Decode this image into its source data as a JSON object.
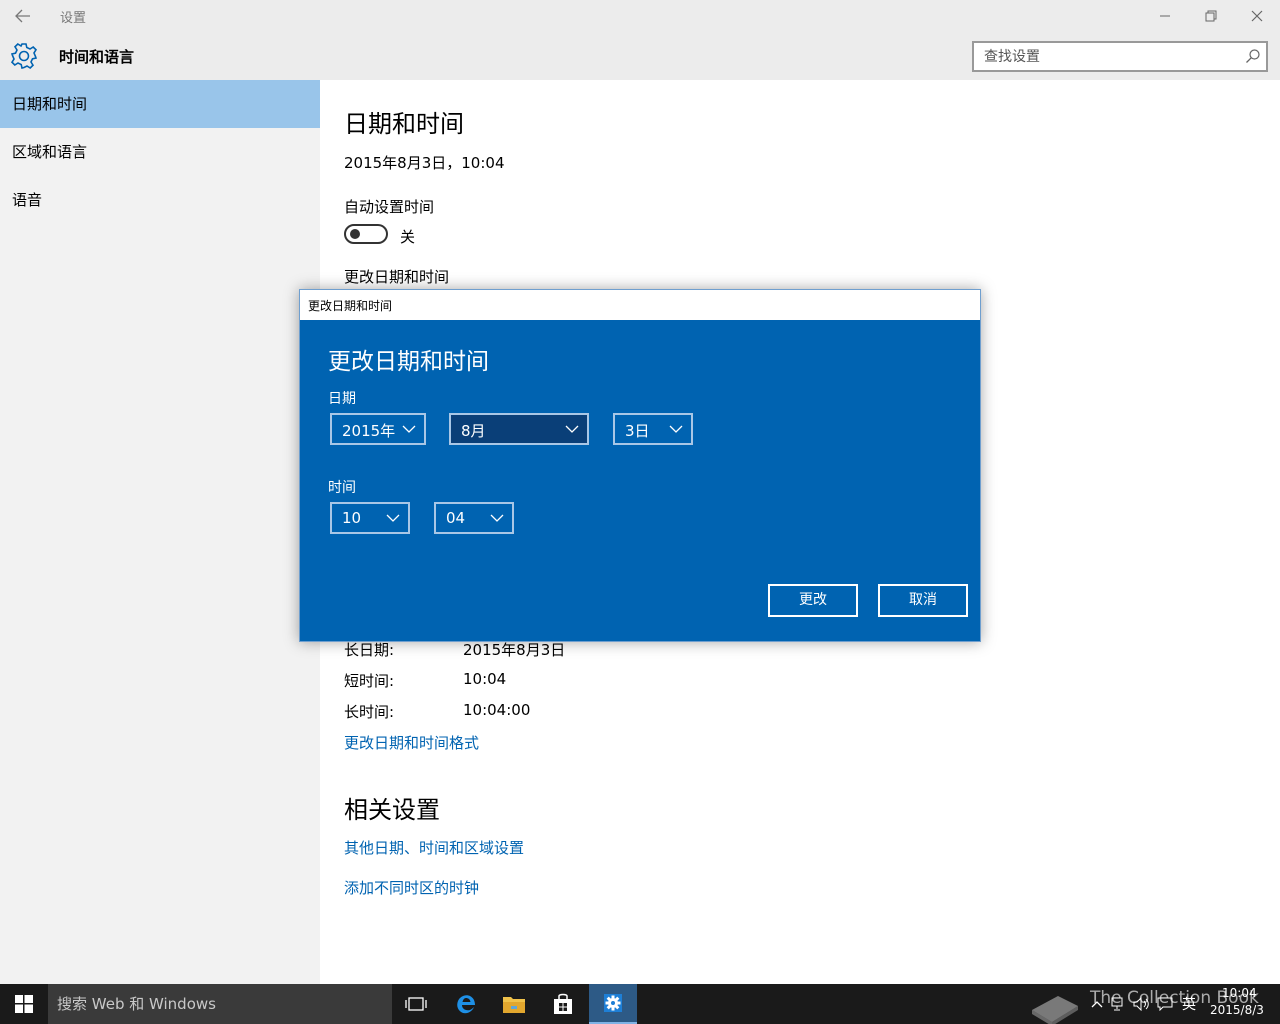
{
  "window": {
    "title": "设置",
    "header_title": "时间和语言",
    "search_placeholder": "查找设置"
  },
  "sidebar": {
    "items": [
      {
        "label": "日期和时间",
        "selected": true
      },
      {
        "label": "区域和语言",
        "selected": false
      },
      {
        "label": "语音",
        "selected": false
      }
    ]
  },
  "main": {
    "heading": "日期和时间",
    "current_datetime": "2015年8月3日，10:04",
    "auto_time_label": "自动设置时间",
    "auto_time_state": "关",
    "change_label": "更改日期和时间",
    "formats": [
      {
        "label": "长日期:",
        "value": "2015年8月3日"
      },
      {
        "label": "短时间:",
        "value": "10:04"
      },
      {
        "label": "长时间:",
        "value": "10:04:00"
      }
    ],
    "change_format_link": "更改日期和时间格式",
    "related_heading": "相关设置",
    "related_links": [
      "其他日期、时间和区域设置",
      "添加不同时区的时钟"
    ]
  },
  "dialog": {
    "window_title": "更改日期和时间",
    "heading": "更改日期和时间",
    "date_label": "日期",
    "year": "2015年",
    "month": "8月",
    "day": "3日",
    "time_label": "时间",
    "hour": "10",
    "minute": "04",
    "change_button": "更改",
    "cancel_button": "取消"
  },
  "taskbar": {
    "search_placeholder": "搜索 Web 和 Windows",
    "ime": "英",
    "clock_time": "10:04",
    "clock_date": "2015/8/3",
    "watermark": "The Collection Book"
  },
  "colors": {
    "accent": "#0063b1",
    "sidebar_selected": "#99c5ea",
    "link": "#0063b1",
    "taskbar": "#1a1a1a"
  }
}
